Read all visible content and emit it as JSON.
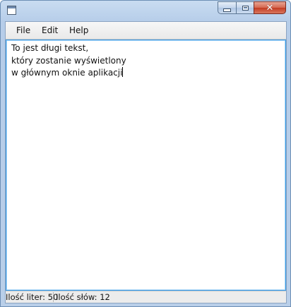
{
  "window": {
    "title": "",
    "controls": {
      "minimize_icon": "minimize-icon",
      "maximize_icon": "maximize-icon",
      "close_icon": "close-icon",
      "close_glyph": "✕"
    }
  },
  "menubar": {
    "items": [
      {
        "label": "File"
      },
      {
        "label": "Edit"
      },
      {
        "label": "Help"
      }
    ]
  },
  "editor": {
    "lines": [
      "To jest długi tekst,",
      "który zostanie wyświetlony",
      "w głównym oknie aplikacji"
    ]
  },
  "statusbar": {
    "letters": "Ilość liter: 50",
    "words": "Ilość słów: 12"
  },
  "colors": {
    "titlebar": "#b9cfe9",
    "close_button": "#c23b22",
    "editor_focus_border": "#3d9ae3"
  }
}
